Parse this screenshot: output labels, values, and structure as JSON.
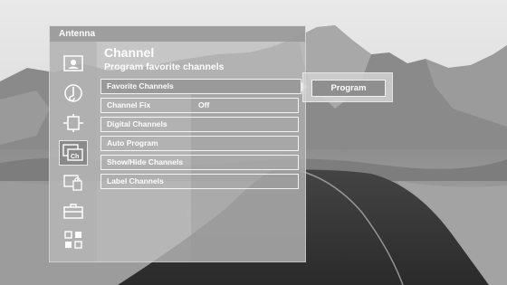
{
  "header": {
    "title": "Antenna"
  },
  "page": {
    "title": "Channel",
    "subtitle": "Program favorite channels"
  },
  "sidebar": {
    "icons": [
      "picture-icon",
      "audio-icon",
      "display-icon",
      "channel-icon",
      "lock-icon",
      "setup-icon",
      "apps-icon"
    ],
    "selected_label": "Ch"
  },
  "menu": {
    "items": [
      {
        "label": "Favorite Channels",
        "value": ""
      },
      {
        "label": "Channel Fix",
        "value": "Off"
      },
      {
        "label": "Digital Channels",
        "value": ""
      },
      {
        "label": "Auto Program",
        "value": ""
      },
      {
        "label": "Show/Hide Channels",
        "value": ""
      },
      {
        "label": "Label Channels",
        "value": ""
      }
    ]
  },
  "submenu": {
    "button_label": "Program"
  },
  "colors": {
    "accent": "#8f8f8f",
    "text": "#ffffff",
    "border": "#f0f0f0"
  }
}
